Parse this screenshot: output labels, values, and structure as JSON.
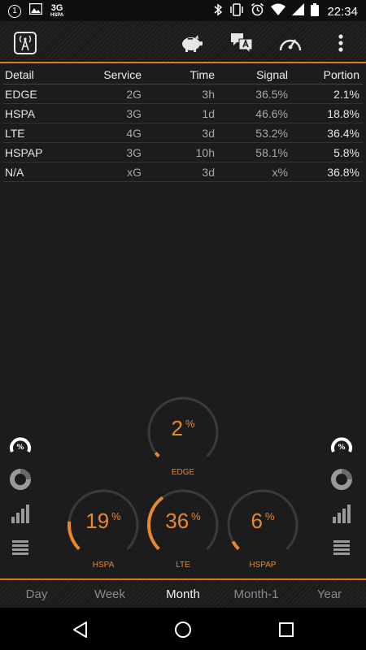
{
  "status_bar": {
    "notification_count": "1",
    "network_gen": "3G",
    "network_sub": "HSPA",
    "time": "22:34"
  },
  "toolbar": {
    "icons": [
      "signal-tower-icon",
      "piggy-bank-icon",
      "translate-icon",
      "speedometer-icon",
      "more-vert-icon"
    ],
    "accent_color": "#e27a1c"
  },
  "table": {
    "headers": [
      "Detail",
      "Service",
      "Time",
      "Signal",
      "Portion"
    ],
    "rows": [
      [
        "EDGE",
        "2G",
        "3h",
        "36.5%",
        "2.1%"
      ],
      [
        "HSPA",
        "3G",
        "1d",
        "46.6%",
        "18.8%"
      ],
      [
        "LTE",
        "4G",
        "3d",
        "53.2%",
        "36.4%"
      ],
      [
        "HSPAP",
        "3G",
        "10h",
        "58.1%",
        "5.8%"
      ],
      [
        "N/A",
        "xG",
        "3d",
        "x%",
        "36.8%"
      ]
    ]
  },
  "side_icons": [
    "percent-gauge-icon",
    "donut-chart-icon",
    "signal-bars-icon",
    "list-view-icon"
  ],
  "percent_symbol": "%",
  "gauges": [
    {
      "label": "EDGE",
      "value": "2",
      "fraction": 0.021
    },
    {
      "label": "HSPA",
      "value": "19",
      "fraction": 0.188
    },
    {
      "label": "LTE",
      "value": "36",
      "fraction": 0.364
    },
    {
      "label": "HSPAP",
      "value": "6",
      "fraction": 0.058
    }
  ],
  "tabs": {
    "items": [
      "Day",
      "Week",
      "Month",
      "Month-1",
      "Year"
    ],
    "active": "Month"
  },
  "nav": [
    "back-icon",
    "home-icon",
    "recents-icon"
  ]
}
